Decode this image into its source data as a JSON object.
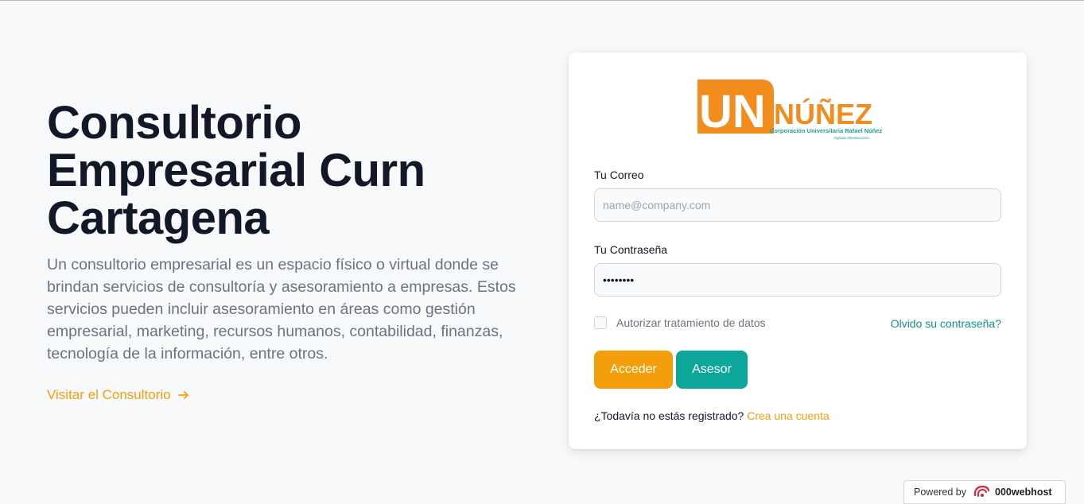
{
  "hero": {
    "title": "Consultorio Empresarial Curn Cartagena",
    "description": "Un consultorio empresarial es un espacio físico o virtual donde se brindan servicios de consultoría y asesoramiento a empresas. Estos servicios pueden incluir asesoramiento en áreas como gestión empresarial, marketing, recursos humanos, contabilidad, finanzas, tecnología de la información, entre otros.",
    "link_label": "Visitar el Consultorio"
  },
  "logo": {
    "initials": "UN",
    "name": "INÚÑEZ",
    "subtitle": "Corporación Universitaria Rafael Núñez",
    "tagline": "Vigilada Mineducación"
  },
  "login": {
    "email_label": "Tu Correo",
    "email_placeholder": "name@company.com",
    "email_value": "",
    "password_label": "Tu Contraseña",
    "password_value": "••••••••",
    "authorize_label": "Autorizar tratamiento de datos",
    "forgot_label": "Olvido su contraseña?",
    "acceder_label": "Acceder",
    "asesor_label": "Asesor",
    "register_text": "¿Todavía no estás registrado?",
    "register_link": "Crea una cuenta"
  },
  "footer": {
    "powered_by": "Powered by",
    "host_brand": "000webhost"
  },
  "colors": {
    "accent_orange": "#f59e0b",
    "accent_teal": "#0ea59a",
    "heading": "#111827",
    "body_text": "#6b7280"
  }
}
